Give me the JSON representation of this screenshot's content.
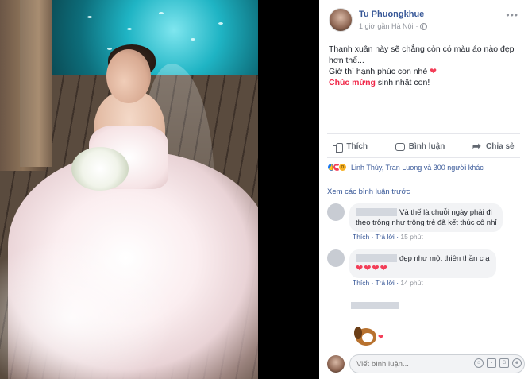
{
  "post": {
    "author": "Tu Phuongkhue",
    "time": "1 giờ",
    "location_prefix": "gần Hà Nội",
    "text_line1": "Thanh xuân này sẽ chẳng còn có màu áo nào đẹp",
    "text_line2": "hơn thế...",
    "text_line3": "Giờ thì hạnh phúc con nhé",
    "heart": "❤",
    "text_highlight": "Chúc mừng",
    "text_line4_rest": " sinh nhật con!"
  },
  "actions": {
    "like": "Thích",
    "comment": "Bình luận",
    "share": "Chia sẻ"
  },
  "reactions": {
    "summary": "Linh Thùy, Tran Luong và 300 người khác"
  },
  "comments": {
    "view_more": "Xem các bình luận trước",
    "items": [
      {
        "line1": "Và thế là chuỗi ngày phải đi",
        "line2": "theo trông như trông trẻ đã kết thúc cô nhỉ",
        "like": "Thích",
        "reply": "Trả lời",
        "time": "15 phút"
      },
      {
        "text": "đẹp như một thiên thần c ạ",
        "hearts": "❤❤❤❤",
        "like": "Thích",
        "reply": "Trả lời",
        "time": "14 phút"
      }
    ]
  },
  "composer": {
    "placeholder": "Viết bình luận..."
  },
  "colors": {
    "link": "#385898",
    "love": "#f33e58",
    "highlight": "#f02849"
  }
}
